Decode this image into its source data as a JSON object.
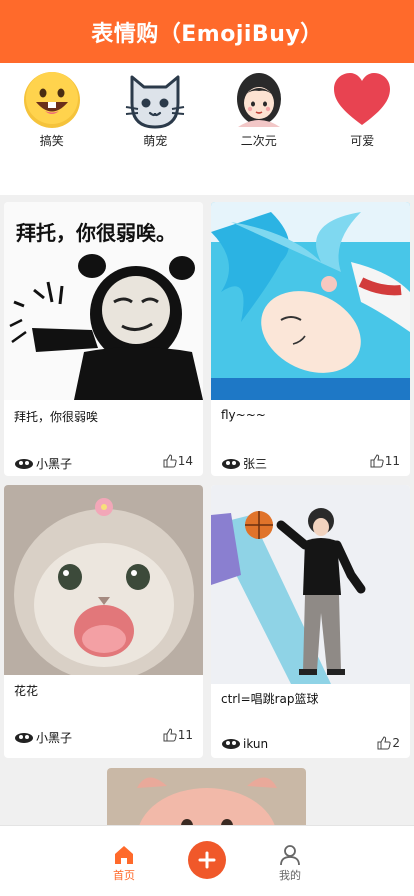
{
  "header": {
    "title": "表情购（EmojiBuy）"
  },
  "categories": [
    {
      "label": "搞笑",
      "icon": "laughing-face-icon"
    },
    {
      "label": "萌宠",
      "icon": "cat-face-icon"
    },
    {
      "label": "二次元",
      "icon": "anime-girl-icon"
    },
    {
      "label": "可爱",
      "icon": "heart-icon"
    }
  ],
  "cards": [
    {
      "image_text": "拜托，你很弱唉。",
      "image_desc": "panda-meme-image",
      "title": "拜托，你很弱唉",
      "author": "小黑子",
      "likes": "14"
    },
    {
      "image_desc": "anime-swimming-image",
      "title": "fly~~~",
      "author": "张三",
      "likes": "11"
    },
    {
      "image_desc": "cat-meme-image",
      "title": "花花",
      "author": "小黑子",
      "likes": "11"
    },
    {
      "image_desc": "basketball-player-image",
      "title": "ctrl=唱跳rap篮球",
      "author": "ikun",
      "likes": "2"
    },
    {
      "image_desc": "pink-pig-image"
    }
  ],
  "tabbar": {
    "home_label": "首页",
    "mine_label": "我的"
  },
  "colors": {
    "accent": "#ff6a2b",
    "add_button": "#f0582a"
  }
}
